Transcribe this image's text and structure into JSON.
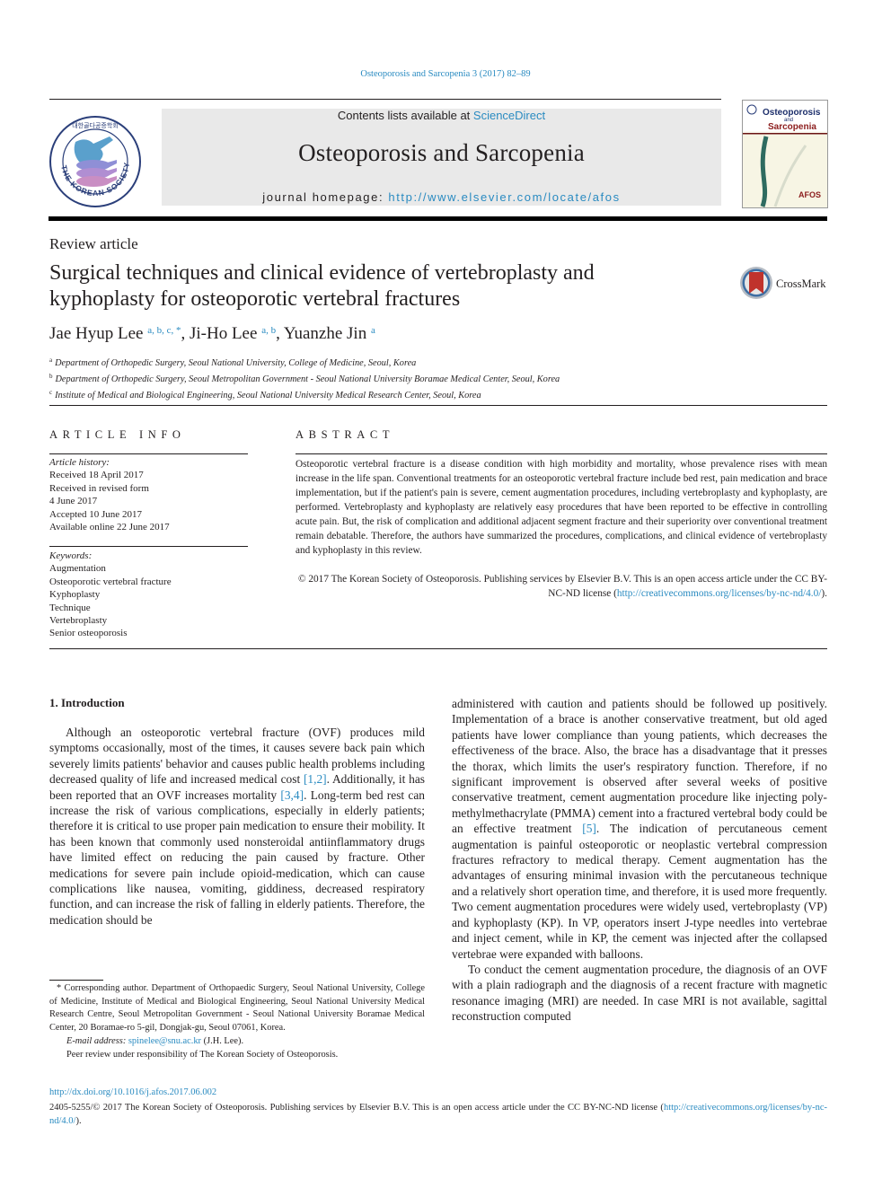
{
  "running_head": "Osteoporosis and Sarcopenia 3 (2017) 82–89",
  "masthead": {
    "contents_prefix": "Contents lists available at ",
    "contents_link": "ScienceDirect",
    "journal_name": "Osteoporosis and Sarcopenia",
    "homepage_prefix": "journal homepage: ",
    "homepage_url": "http://www.elsevier.com/locate/afos",
    "society_logo_outer_text": "THE KOREAN SOCIETY OF OSTEOPOROSIS",
    "society_logo_top_text": "대한골다공증학회",
    "cover": {
      "title_line1": "Osteoporosis",
      "title_line2": "and",
      "title_line3": "Sarcopenia",
      "badge": "AFOS"
    },
    "colors": {
      "link": "#2a8bc1",
      "band": "#e9e9e9",
      "cover_title_blue": "#1d2f6b",
      "cover_title_red": "#8c1d1d"
    }
  },
  "article": {
    "type": "Review article",
    "title": "Surgical techniques and clinical evidence of vertebroplasty and kyphoplasty for osteoporotic vertebral fractures",
    "crossmark_label": "CrossMark",
    "authors": [
      {
        "name": "Jae Hyup Lee",
        "sup": "a, b, c, *"
      },
      {
        "name": "Ji-Ho Lee",
        "sup": "a, b"
      },
      {
        "name": "Yuanzhe Jin",
        "sup": "a"
      }
    ],
    "affiliations": [
      {
        "key": "a",
        "text": "Department of Orthopedic Surgery, Seoul National University, College of Medicine, Seoul, Korea"
      },
      {
        "key": "b",
        "text": "Department of Orthopedic Surgery, Seoul Metropolitan Government - Seoul National University Boramae Medical Center, Seoul, Korea"
      },
      {
        "key": "c",
        "text": "Institute of Medical and Biological Engineering, Seoul National University Medical Research Center, Seoul, Korea"
      }
    ]
  },
  "article_info": {
    "heading": "ARTICLE INFO",
    "history_label": "Article history:",
    "history": [
      "Received 18 April 2017",
      "Received in revised form",
      "4 June 2017",
      "Accepted 10 June 2017",
      "Available online 22 June 2017"
    ],
    "keywords_label": "Keywords:",
    "keywords": [
      "Augmentation",
      "Osteoporotic vertebral fracture",
      "Kyphoplasty",
      "Technique",
      "Vertebroplasty",
      "Senior osteoporosis"
    ]
  },
  "abstract": {
    "heading": "ABSTRACT",
    "body": "Osteoporotic vertebral fracture is a disease condition with high morbidity and mortality, whose prevalence rises with mean increase in the life span. Conventional treatments for an osteoporotic vertebral fracture include bed rest, pain medication and brace implementation, but if the patient's pain is severe, cement augmentation procedures, including vertebroplasty and kyphoplasty, are performed. Vertebroplasty and kyphoplasty are relatively easy procedures that have been reported to be effective in controlling acute pain. But, the risk of complication and additional adjacent segment fracture and their superiority over conventional treatment remain debatable. Therefore, the authors have summarized the procedures, complications, and clinical evidence of vertebroplasty and kyphoplasty in this review.",
    "copyright_prefix": "© 2017 The Korean Society of Osteoporosis. Publishing services by Elsevier B.V. This is an open access article under the CC BY-NC-ND license (",
    "license_url": "http://creativecommons.org/licenses/by-nc-nd/4.0/",
    "copyright_suffix": ")."
  },
  "introduction": {
    "heading": "1.  Introduction",
    "p1": {
      "a": "Although an osteoporotic vertebral fracture (OVF) produces mild symptoms occasionally, most of the times, it causes severe back pain which severely limits patients' behavior and causes public health problems including decreased quality of life and increased medical cost ",
      "ref1": "[1,2]",
      "b": ". Additionally, it has been reported that an OVF increases mortality ",
      "ref2": "[3,4]",
      "c": ". Long-term bed rest can increase the risk of various complications, especially in elderly patients; therefore it is critical to use proper pain medication to ensure their mobility. It has been known that commonly used nonsteroidal anti-inflammatory drugs have limited effect on reducing the pain caused by fracture. Other medications for severe pain include opioid-medication, which can cause complications like nausea, vomiting, giddiness, decreased respiratory function, and can increase the risk of falling in elderly patients. Therefore, the medication should be administered with caution and patients should be followed up positively. Implementation of a brace is another conservative treatment, but old aged patients have lower compliance than young patients, which decreases the effectiveness of the brace. Also, the brace has a disadvantage that it presses the thorax, which limits the user's respiratory function. Therefore, if no significant improvement is observed after several weeks of positive conservative treatment, cement augmentation procedure like injecting polymethylmethacrylate (PMMA) cement into a fractured vertebral body could be an effective treatment ",
      "ref3": "[5]",
      "d": ". The indication of percutaneous cement augmentation is painful osteoporotic or neoplastic vertebral compression fractures refractory to medical therapy. Cement augmentation has the advantages of ensuring minimal invasion with the percutaneous technique and a relatively short operation time, and therefore, it is used more frequently. Two cement augmentation procedures were widely used, vertebroplasty (VP) and kyphoplasty (KP). In VP, operators insert J-type needles into vertebrae and inject cement, while in KP, the cement was injected after the collapsed vertebrae were expanded with balloons."
    },
    "p2": "To conduct the cement augmentation procedure, the diagnosis of an OVF with a plain radiograph and the diagnosis of a recent fracture with magnetic resonance imaging (MRI) are needed. In case MRI is not available, sagittal reconstruction computed"
  },
  "col1_text": {
    "a": "Although an osteoporotic vertebral fracture (OVF) produces mild symptoms occasionally, most of the times, it causes severe back pain which severely limits patients' behavior and causes public health problems including decreased quality of life and increased medical cost ",
    "ref1": "[1,2]",
    "b": ". Additionally, it has been reported that an OVF increases mortality ",
    "ref2": "[3,4]",
    "c": ". Long-term bed rest can increase the risk of various complications, especially in elderly patients; therefore it is critical to use proper pain medication to ensure their mobility. It has been known that commonly used nonsteroidal anti­inflammatory drugs have limited effect on reducing the pain caused by fracture. Other medications for severe pain include opioid-medication, which can cause complications like nausea, vomiting, giddiness, decreased respiratory function, and can increase the risk of falling in elderly patients. Therefore, the medication should be"
  },
  "col2_text": {
    "a": "administered with caution and patients should be followed up positively. Implementation of a brace is another conservative treatment, but old aged patients have lower compliance than young patients, which decreases the effectiveness of the brace. Also, the brace has a disadvantage that it presses the thorax, which limits the user's respiratory function. Therefore, if no significant improve­ment is observed after several weeks of positive conservative treatment, cement augmentation procedure like injecting poly­methylmethacrylate (PMMA) cement into a fractured vertebral body could be an effective treatment ",
    "ref3": "[5]",
    "b": ". The indication of percu­taneous cement augmentation is painful osteoporotic or neoplastic vertebral compression fractures refractory to medical therapy. Cement augmentation has the advantages of ensuring minimal invasion with the percutaneous technique and a relatively short operation time, and therefore, it is used more frequently. Two cement augmentation procedures were widely used, verte­broplasty (VP) and kyphoplasty (KP). In VP, operators insert J-type needles into vertebrae and inject cement, while in KP, the cement was injected after the collapsed vertebrae were expanded with balloons.",
    "p2": "To conduct the cement augmentation procedure, the diagnosis of an OVF with a plain radiograph and the diagnosis of a recent fracture with magnetic resonance imaging (MRI) are needed. In case MRI is not available, sagittal reconstruction computed"
  },
  "footnotes": {
    "corresponding": "* Corresponding author. Department of Orthopaedic Surgery, Seoul National University, College of Medicine, Institute of Medical and Biological Engineering, Seoul National University Medical Research Centre, Seoul Metropolitan Govern­ment - Seoul National University Boramae Medical Center, 20 Boramae-ro 5-gil, Dongjak-gu, Seoul 07061, Korea.",
    "email_label": "E-mail address: ",
    "email": "spinelee@snu.ac.kr",
    "email_suffix": " (J.H. Lee).",
    "peer_review": "Peer review under responsibility of The Korean Society of Osteoporosis."
  },
  "page_footer": {
    "doi": "http://dx.doi.org/10.1016/j.afos.2017.06.002",
    "license_prefix": "2405-5255/© 2017 The Korean Society of Osteoporosis. Publishing services by Elsevier B.V. This is an open access article under the CC BY-NC-ND license (",
    "license_url": "http://creativecommons.org/licenses/by-nc-nd/4.0/",
    "license_suffix": ")."
  }
}
